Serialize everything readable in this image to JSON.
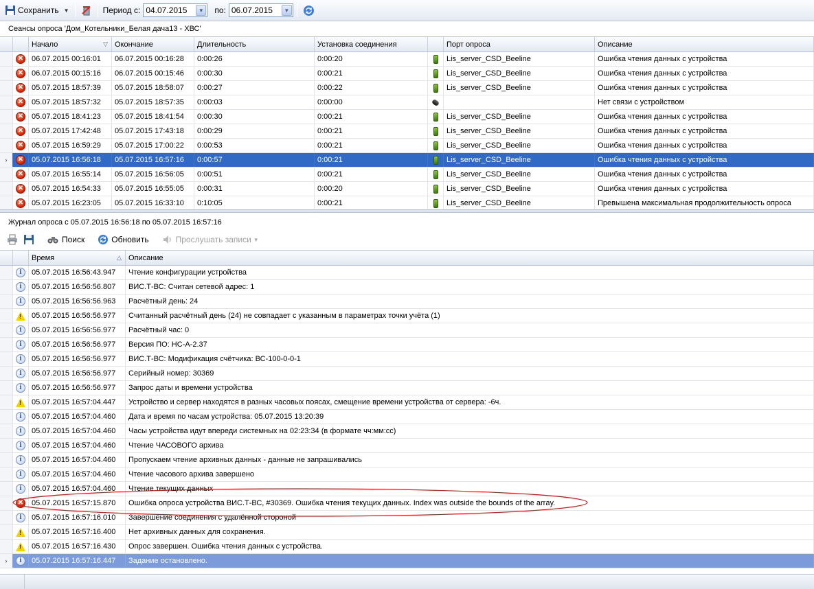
{
  "toolbar": {
    "save_label": "Сохранить",
    "period_from_label": "Период с:",
    "period_from_value": "04.07.2015",
    "period_to_label": "по:",
    "period_to_value": "06.07.2015"
  },
  "sessions": {
    "title": "Сеансы опроса 'Дом_Котельники_Белая дача13 - ХВС'",
    "columns": [
      "Начало",
      "Окончание",
      "Длительность",
      "Установка соединения",
      "Порт опроса",
      "Описание"
    ],
    "rows": [
      {
        "start": "06.07.2015 00:16:01",
        "end": "06.07.2015 00:16:28",
        "duration": "0:00:26",
        "connect": "0:00:20",
        "port": "Lis_server_CSD_Beeline",
        "desc": "Ошибка чтения данных с устройства"
      },
      {
        "start": "06.07.2015 00:15:16",
        "end": "06.07.2015 00:15:46",
        "duration": "0:00:30",
        "connect": "0:00:21",
        "port": "Lis_server_CSD_Beeline",
        "desc": "Ошибка чтения данных с устройства"
      },
      {
        "start": "05.07.2015 18:57:39",
        "end": "05.07.2015 18:58:07",
        "duration": "0:00:27",
        "connect": "0:00:22",
        "port": "Lis_server_CSD_Beeline",
        "desc": "Ошибка чтения данных с устройства"
      },
      {
        "start": "05.07.2015 18:57:32",
        "end": "05.07.2015 18:57:35",
        "duration": "0:00:03",
        "connect": "0:00:00",
        "port": "",
        "desc": "Нет связи с устройством"
      },
      {
        "start": "05.07.2015 18:41:23",
        "end": "05.07.2015 18:41:54",
        "duration": "0:00:30",
        "connect": "0:00:21",
        "port": "Lis_server_CSD_Beeline",
        "desc": "Ошибка чтения данных с устройства"
      },
      {
        "start": "05.07.2015 17:42:48",
        "end": "05.07.2015 17:43:18",
        "duration": "0:00:29",
        "connect": "0:00:21",
        "port": "Lis_server_CSD_Beeline",
        "desc": "Ошибка чтения данных с устройства"
      },
      {
        "start": "05.07.2015 16:59:29",
        "end": "05.07.2015 17:00:22",
        "duration": "0:00:53",
        "connect": "0:00:21",
        "port": "Lis_server_CSD_Beeline",
        "desc": "Ошибка чтения данных с устройства"
      },
      {
        "start": "05.07.2015 16:56:18",
        "end": "05.07.2015 16:57:16",
        "duration": "0:00:57",
        "connect": "0:00:21",
        "port": "Lis_server_CSD_Beeline",
        "desc": "Ошибка чтения данных с устройства"
      },
      {
        "start": "05.07.2015 16:55:14",
        "end": "05.07.2015 16:56:05",
        "duration": "0:00:51",
        "connect": "0:00:21",
        "port": "Lis_server_CSD_Beeline",
        "desc": "Ошибка чтения данных с устройства"
      },
      {
        "start": "05.07.2015 16:54:33",
        "end": "05.07.2015 16:55:05",
        "duration": "0:00:31",
        "connect": "0:00:20",
        "port": "Lis_server_CSD_Beeline",
        "desc": "Ошибка чтения данных с устройства"
      },
      {
        "start": "05.07.2015 16:23:05",
        "end": "05.07.2015 16:33:10",
        "duration": "0:10:05",
        "connect": "0:00:21",
        "port": "Lis_server_CSD_Beeline",
        "desc": "Превышена максимальная продолжительность опроса"
      }
    ]
  },
  "journal": {
    "title": "Журнал опроса с 05.07.2015 16:56:18 по 05.07.2015 16:57:16",
    "search_label": "Поиск",
    "refresh_label": "Обновить",
    "listen_label": "Прослушать записи",
    "columns": [
      "Время",
      "Описание"
    ],
    "rows": [
      {
        "time": "05.07.2015 16:56:43.947",
        "desc": "Чтение конфигурации устройства"
      },
      {
        "time": "05.07.2015 16:56:56.807",
        "desc": "ВИС.Т-ВС: Считан сетевой адрес: 1"
      },
      {
        "time": "05.07.2015 16:56:56.963",
        "desc": "Расчётный день: 24"
      },
      {
        "time": "05.07.2015 16:56:56.977",
        "desc": "Считанный расчётный день (24) не совпадает с указанным в параметрах точки учёта (1)"
      },
      {
        "time": "05.07.2015 16:56:56.977",
        "desc": "Расчётный час: 0"
      },
      {
        "time": "05.07.2015 16:56:56.977",
        "desc": "Версия ПО: НС-А-2.37"
      },
      {
        "time": "05.07.2015 16:56:56.977",
        "desc": "ВИС.Т-ВС: Модификация счётчика: ВС-100-0-0-1"
      },
      {
        "time": "05.07.2015 16:56:56.977",
        "desc": "Серийный номер: 30369"
      },
      {
        "time": "05.07.2015 16:56:56.977",
        "desc": "Запрос даты и времени устройства"
      },
      {
        "time": "05.07.2015 16:57:04.447",
        "desc": "Устройство и сервер находятся в разных часовых поясах, смещение времени устройства от сервера: -6ч."
      },
      {
        "time": "05.07.2015 16:57:04.460",
        "desc": "Дата и время по часам устройства: 05.07.2015 13:20:39"
      },
      {
        "time": "05.07.2015 16:57:04.460",
        "desc": "Часы устройства идут впереди системных на 02:23:34 (в формате чч:мм:сс)"
      },
      {
        "time": "05.07.2015 16:57:04.460",
        "desc": "Чтение ЧАСОВОГО архива"
      },
      {
        "time": "05.07.2015 16:57:04.460",
        "desc": "Пропускаем чтение архивных данных - данные не запрашивались"
      },
      {
        "time": "05.07.2015 16:57:04.460",
        "desc": "Чтение часового архива завершено"
      },
      {
        "time": "05.07.2015 16:57:04.460",
        "desc": "Чтение текущих данных"
      },
      {
        "time": "05.07.2015 16:57:15.870",
        "desc": "Ошибка опроса устройства ВИС.Т-ВС, #30369. Ошибка чтения текущих данных. Index was outside the bounds of the array."
      },
      {
        "time": "05.07.2015 16:57:16.010",
        "desc": "Завершение соединения с удалённой стороной"
      },
      {
        "time": "05.07.2015 16:57:16.400",
        "desc": "Нет архивных данных для сохранения."
      },
      {
        "time": "05.07.2015 16:57:16.430",
        "desc": "Опрос завершен. Ошибка чтения данных с устройства."
      },
      {
        "time": "05.07.2015 16:57:16.447",
        "desc": "Задание остановлено."
      }
    ]
  },
  "colors": {
    "selection": "#316ac5",
    "selection_inactive": "#7b9bdb",
    "annotation": "#c81e1e"
  }
}
